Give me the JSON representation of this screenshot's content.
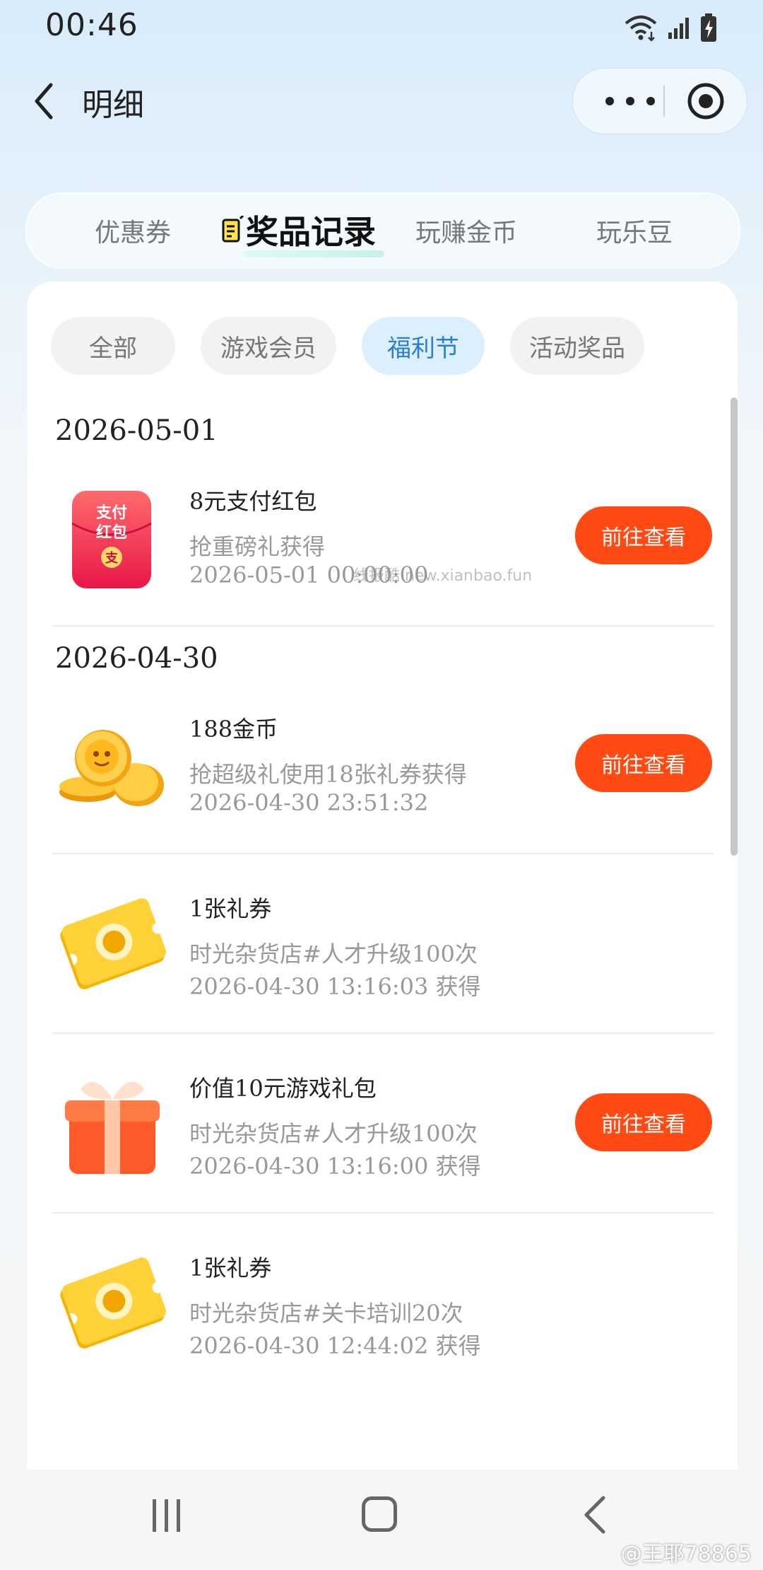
{
  "status": {
    "time": "00:46"
  },
  "header": {
    "title": "明细"
  },
  "tabs": [
    {
      "label": "优惠券"
    },
    {
      "label": "奖品记录"
    },
    {
      "label": "玩赚金币"
    },
    {
      "label": "玩乐豆"
    }
  ],
  "filters": [
    {
      "label": "全部"
    },
    {
      "label": "游戏会员"
    },
    {
      "label": "福利节"
    },
    {
      "label": "活动奖品"
    }
  ],
  "groups": [
    {
      "date": "2026-05-01",
      "items": [
        {
          "title": "8元支付红包",
          "desc": "抢重磅礼获得",
          "time": "2026-05-01 00:00:00",
          "button": "前往查看",
          "icon": "red-envelope-icon",
          "icon_text": "支付红包"
        }
      ]
    },
    {
      "date": "2026-04-30",
      "items": [
        {
          "title": "188金币",
          "desc": "抢超级礼使用18张礼券获得",
          "time": "2026-04-30 23:51:32",
          "button": "前往查看",
          "icon": "gold-coins-icon"
        },
        {
          "title": "1张礼券",
          "desc": "时光杂货店#人才升级100次",
          "time": "2026-04-30 13:16:03 获得",
          "icon": "gift-ticket-icon"
        },
        {
          "title": "价值10元游戏礼包",
          "desc": "时光杂货店#人才升级100次",
          "time": "2026-04-30 13:16:00 获得",
          "button": "前往查看",
          "icon": "gift-box-icon"
        },
        {
          "title": "1张礼券",
          "desc": "时光杂货店#关卡培训20次",
          "time": "2026-04-30 12:44:02 获得",
          "icon": "gift-ticket-icon"
        }
      ]
    }
  ],
  "watermark": "线报酷 new.xianbao.fun",
  "credit": "@王耶78865",
  "colors": {
    "accent": "#ff4a14",
    "chip_active": "#2b7fd0"
  }
}
